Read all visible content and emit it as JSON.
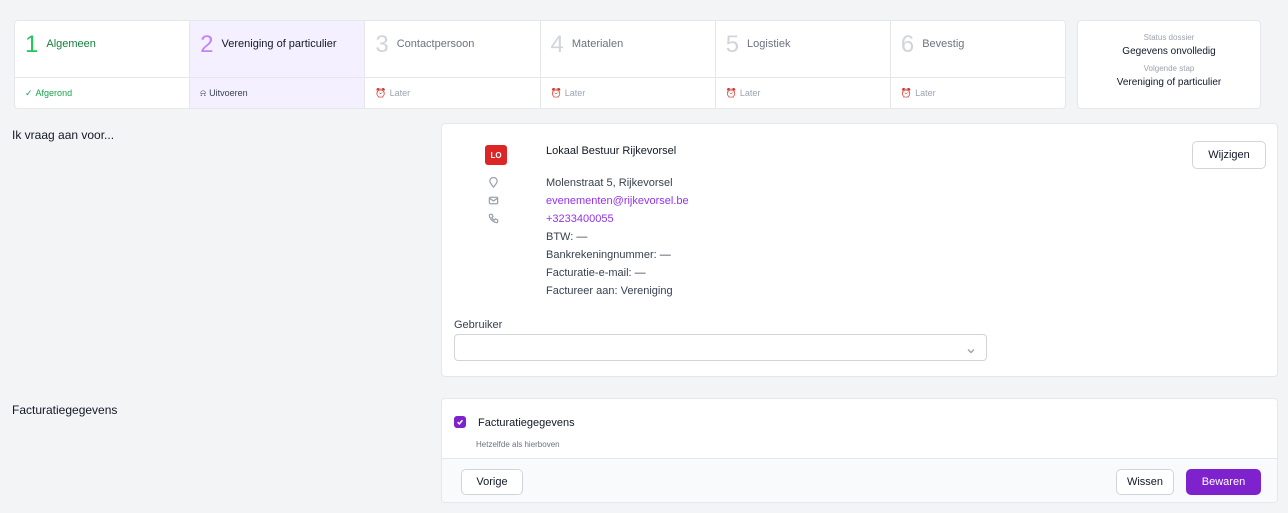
{
  "stepper": {
    "steps": [
      {
        "number": "1",
        "label": "Algemeen",
        "status": "Afgerond",
        "state": "done"
      },
      {
        "number": "2",
        "label": "Vereniging of particulier",
        "status": "Uitvoeren",
        "state": "active"
      },
      {
        "number": "3",
        "label": "Contactpersoon",
        "status": "Later",
        "state": "pending"
      },
      {
        "number": "4",
        "label": "Materialen",
        "status": "Later",
        "state": "pending"
      },
      {
        "number": "5",
        "label": "Logistiek",
        "status": "Later",
        "state": "pending"
      },
      {
        "number": "6",
        "label": "Bevestig",
        "status": "Later",
        "state": "pending"
      }
    ]
  },
  "status_box": {
    "dossier_caption": "Status dossier",
    "dossier_value": "Gegevens onvolledig",
    "next_caption": "Volgende stap",
    "next_value": "Vereniging of particulier"
  },
  "request": {
    "section_title": "Ik vraag aan voor...",
    "badge": "LO",
    "org_name": "Lokaal Bestuur Rijkevorsel",
    "address": "Molenstraat 5, Rijkevorsel",
    "email": "evenementen@rijkevorsel.be",
    "phone": "+3233400055",
    "vat": "BTW: —",
    "bank": "Bankrekeningnummer: —",
    "billing_email": "Facturatie-e-mail: —",
    "bill_to": "Factureer aan: Vereniging",
    "edit_label": "Wijzigen",
    "user_label": "Gebruiker",
    "user_value": ""
  },
  "billing": {
    "section_title": "Facturatiegegevens",
    "checkbox_label": "Facturatiegegevens",
    "checkbox_checked": true,
    "checkbox_sub": "Hetzelfde als hierboven"
  },
  "footer": {
    "prev_label": "Vorige",
    "clear_label": "Wissen",
    "save_label": "Bewaren"
  },
  "colors": {
    "accent": "#7e22ce",
    "done": "#16a34a",
    "badge": "#dc2626",
    "link": "#9333ea"
  }
}
